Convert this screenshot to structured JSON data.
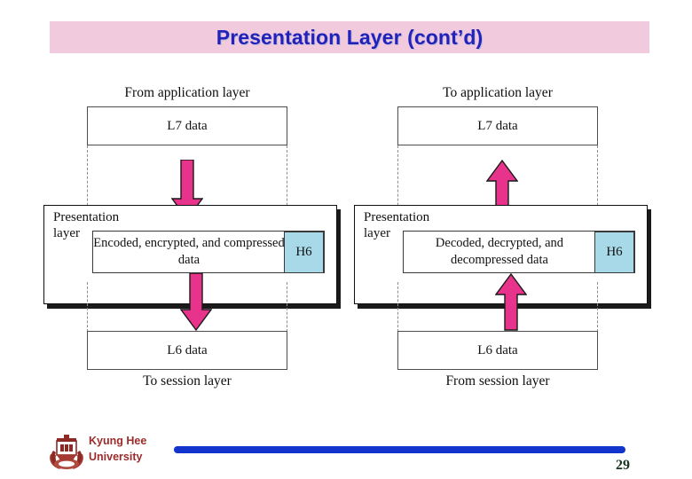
{
  "slide": {
    "title": "Presentation Layer (cont’d)",
    "banner_color": "#f2cade",
    "title_color": "#2222bb",
    "page_number": "29"
  },
  "footer": {
    "logo_icon": "kyung-hee-crest-icon",
    "university_line1": "Kyung Hee",
    "university_line2": "University",
    "rule_color": "#1233cc",
    "text_color": "#9e2b2b"
  },
  "figures": [
    {
      "id": "left",
      "caption_top": "From application layer",
      "caption_bottom": "To session layer",
      "top_box_label": "L7 data",
      "bottom_box_label": "L6 data",
      "layer_label": "Presentation layer",
      "inner_label": "Encoded, encrypted, and compressed data",
      "header_label": "H6",
      "header_color": "#a8d9e8",
      "arrow_direction": "down",
      "arrow_color": "#e8338c"
    },
    {
      "id": "right",
      "caption_top": "To application layer",
      "caption_bottom": "From session layer",
      "top_box_label": "L7 data",
      "bottom_box_label": "L6 data",
      "layer_label": "Presentation layer",
      "inner_label": "Decoded, decrypted, and decompressed data",
      "header_label": "H6",
      "header_color": "#a8d9e8",
      "arrow_direction": "up",
      "arrow_color": "#e8338c"
    }
  ]
}
